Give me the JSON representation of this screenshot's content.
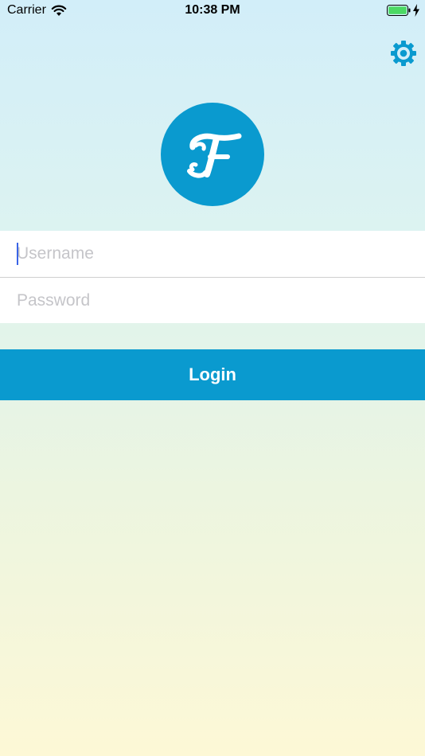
{
  "status_bar": {
    "carrier": "Carrier",
    "time": "10:38 PM",
    "wifi_icon": "wifi-icon",
    "battery_icon": "battery-icon",
    "charging_icon": "charging-bolt-icon"
  },
  "settings": {
    "icon": "gear-icon"
  },
  "logo": {
    "letter": "F",
    "icon": "app-logo-icon"
  },
  "login_form": {
    "username": {
      "value": "",
      "placeholder": "Username"
    },
    "password": {
      "value": "",
      "placeholder": "Password"
    },
    "login_label": "Login"
  },
  "colors": {
    "accent": "#0a9acf",
    "battery_fill": "#4cd964",
    "caret": "#3a64e6",
    "placeholder": "#c5c5c9"
  }
}
